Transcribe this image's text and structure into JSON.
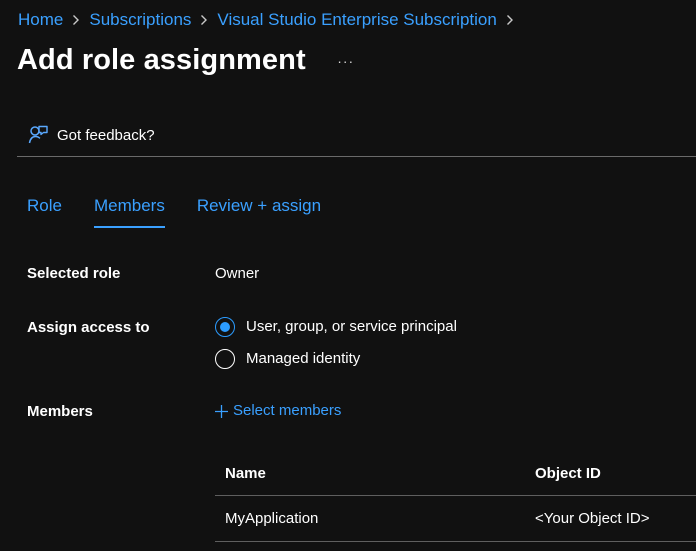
{
  "breadcrumb": {
    "items": [
      "Home",
      "Subscriptions",
      "Visual Studio Enterprise Subscription"
    ]
  },
  "header": {
    "title": "Add role assignment",
    "more_label": "···"
  },
  "feedback": {
    "label": "Got feedback?"
  },
  "tabs": [
    {
      "label": "Role"
    },
    {
      "label": "Members"
    },
    {
      "label": "Review + assign"
    }
  ],
  "form": {
    "selected_role_label": "Selected role",
    "selected_role_value": "Owner",
    "assign_access_label": "Assign access to",
    "assign_access_options": [
      "User, group, or service principal",
      "Managed identity"
    ],
    "members_label": "Members",
    "select_members_label": "Select members"
  },
  "members_table": {
    "columns": [
      "Name",
      "Object ID"
    ],
    "rows": [
      {
        "name": "MyApplication",
        "object_id": "<Your Object ID>"
      }
    ]
  },
  "icons": {
    "breadcrumb_separator": "chevron-right-icon",
    "feedback": "feedback-icon",
    "add": "plus-icon",
    "selected_radio": "radio-selected-icon",
    "unselected_radio": "radio-unselected-icon"
  },
  "colors": {
    "background": "#111111",
    "accent": "#3aa0ff",
    "text": "#ffffff",
    "divider": "#6a6a6a"
  },
  "state": {
    "active_tab": "Members",
    "selected_assign_access": "User, group, or service principal"
  }
}
